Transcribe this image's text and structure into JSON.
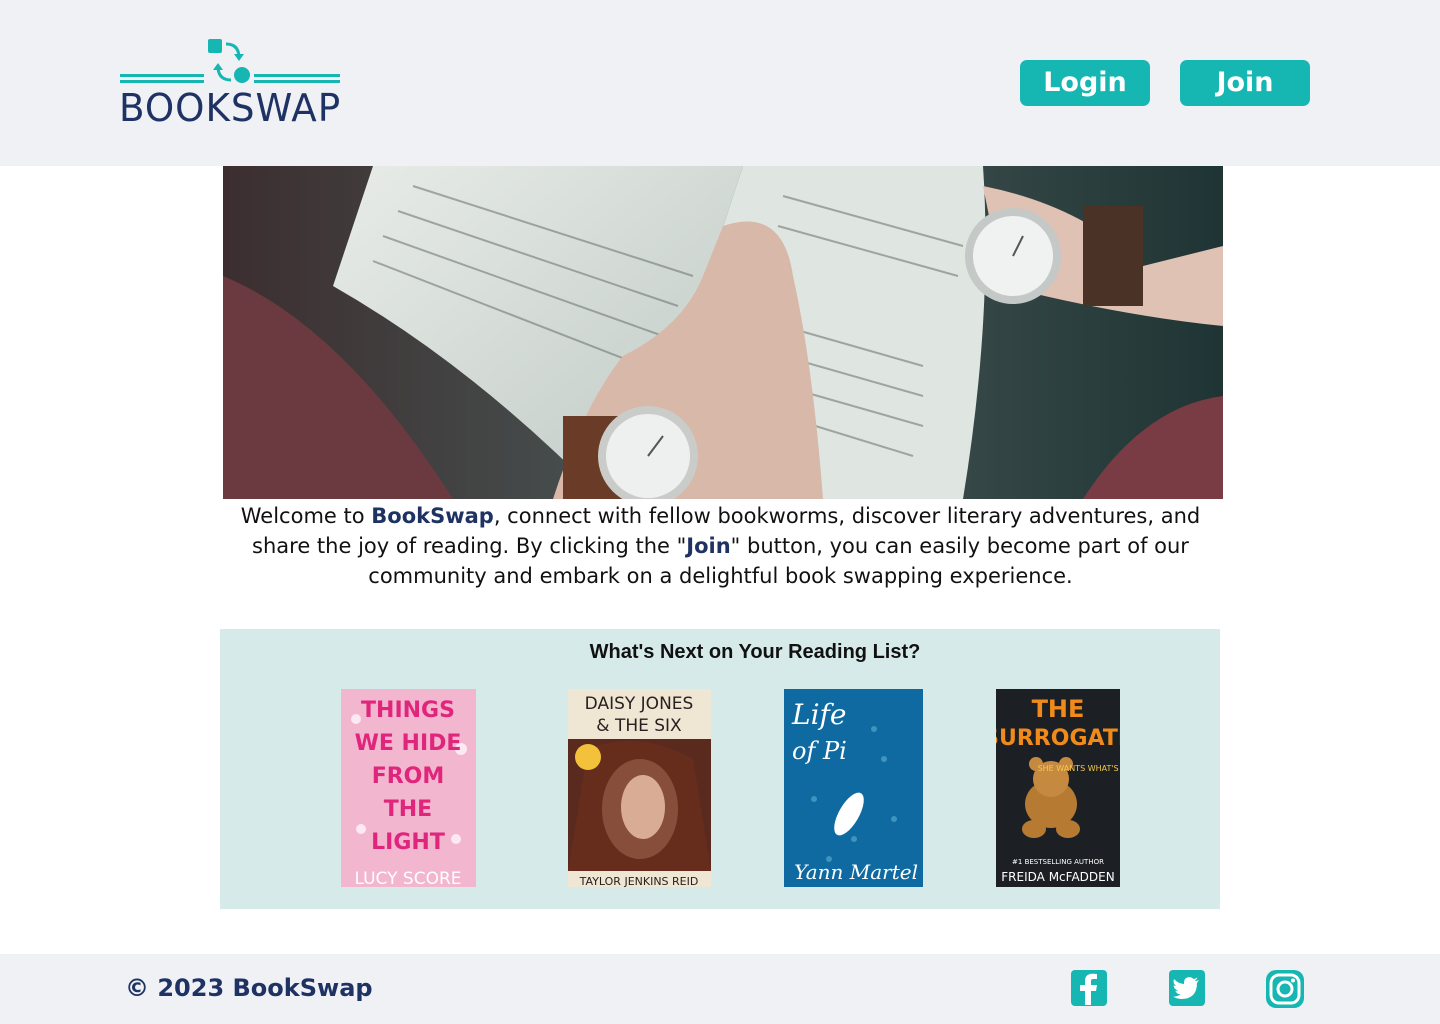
{
  "header": {
    "logo_text": "BOOKSWAP",
    "login_label": "Login",
    "join_label": "Join"
  },
  "welcome": {
    "part1": "Welcome to ",
    "brand": "BookSwap",
    "part2": ", connect with fellow bookworms, discover literary adventures, and share the joy of reading. By clicking the \"",
    "join_word": "Join",
    "part3": "\" button, you can easily become part of our community and embark on a delightful book swapping experience."
  },
  "reading_list": {
    "title": "What's Next on Your Reading List?",
    "books": [
      {
        "title_lines": [
          "THINGS",
          "WE HIDE",
          "FROM",
          "THE",
          "LIGHT"
        ],
        "author": "LUCY SCORE"
      },
      {
        "title_lines": [
          "DAISY JONES",
          "& THE SIX"
        ],
        "author": "TAYLOR JENKINS REID"
      },
      {
        "title_lines": [
          "Life",
          "of Pi"
        ],
        "author": "Yann Martel"
      },
      {
        "title_lines": [
          "THE",
          "SURROGATE"
        ],
        "tagline": "SHE WANTS WHAT'S YOURS",
        "author_note": "#1 BESTSELLING AUTHOR",
        "author": "FREIDA McFADDEN"
      }
    ]
  },
  "footer": {
    "copyright": "© 2023 BookSwap"
  },
  "colors": {
    "accent": "#16b6b2",
    "brand_navy": "#1e3264",
    "header_bg": "#eff1f5",
    "reading_bg": "#d6eaea"
  },
  "icons": [
    "swap-icon",
    "facebook-icon",
    "twitter-icon",
    "instagram-icon"
  ]
}
